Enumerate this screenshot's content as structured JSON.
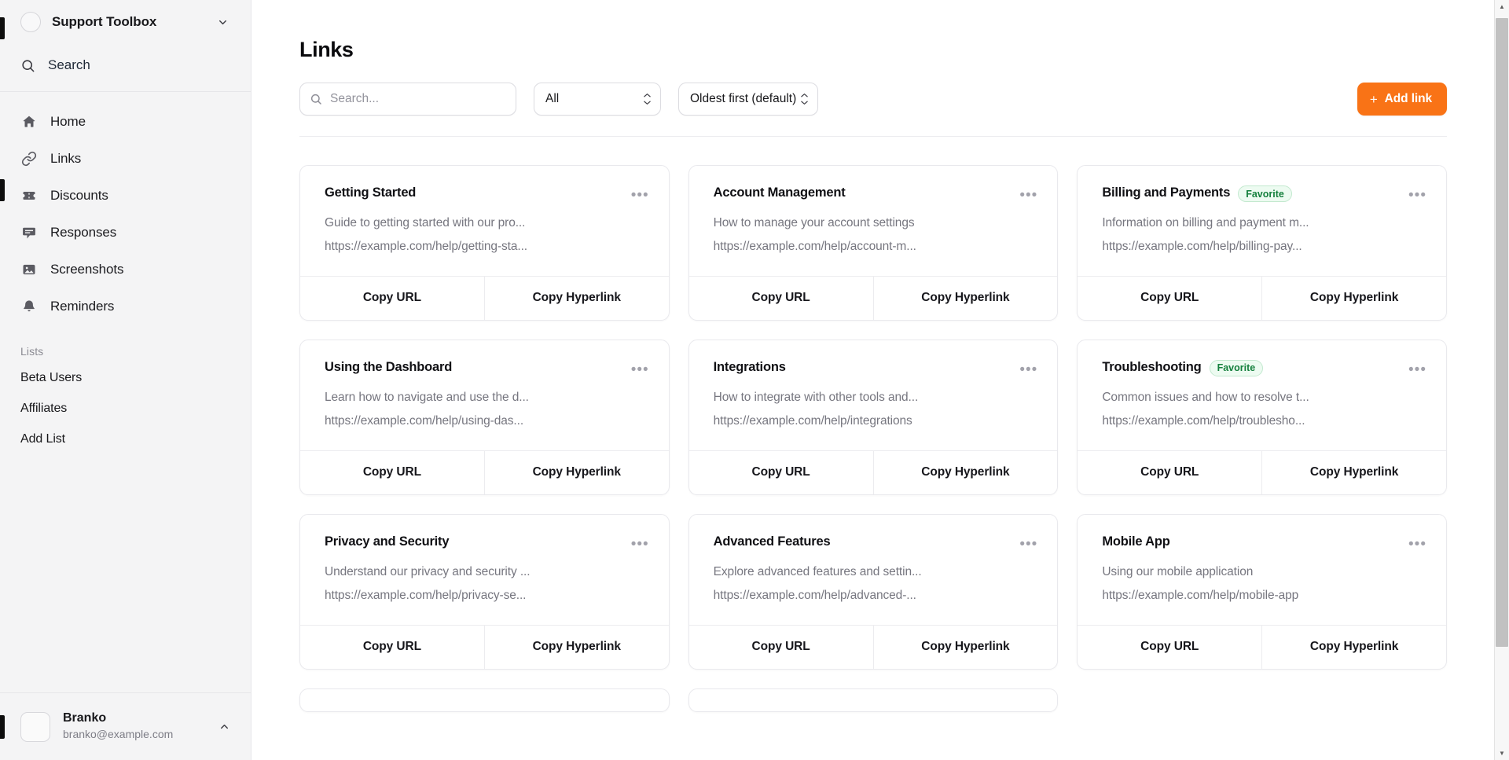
{
  "sidebar": {
    "workspace": {
      "name": "Support Toolbox",
      "chevron_icon": "chevron-down-icon"
    },
    "search": {
      "label": "Search",
      "icon": "search-icon"
    },
    "nav": [
      {
        "label": "Home",
        "icon": "home-icon"
      },
      {
        "label": "Links",
        "icon": "link-icon"
      },
      {
        "label": "Discounts",
        "icon": "ticket-icon"
      },
      {
        "label": "Responses",
        "icon": "chat-icon"
      },
      {
        "label": "Screenshots",
        "icon": "image-icon"
      },
      {
        "label": "Reminders",
        "icon": "bell-icon"
      }
    ],
    "lists_heading": "Lists",
    "lists": [
      {
        "label": "Beta Users"
      },
      {
        "label": "Affiliates"
      },
      {
        "label": "Add List"
      }
    ],
    "user": {
      "name": "Branko",
      "email": "branko@example.com",
      "chevron_icon": "chevron-up-icon"
    }
  },
  "header": {
    "title": "Links"
  },
  "toolbar": {
    "search": {
      "placeholder": "Search...",
      "value": "",
      "icon": "search-icon"
    },
    "filter": {
      "value": "All",
      "icon": "chevron-updown-icon"
    },
    "sort": {
      "value": "Oldest first (default)",
      "icon": "chevron-updown-icon"
    },
    "add_button": {
      "label": "Add link",
      "plus": "+",
      "color": "#f97316"
    }
  },
  "cards": {
    "copy_url_label": "Copy URL",
    "copy_hyperlink_label": "Copy Hyperlink",
    "menu_icon": "ellipsis-icon",
    "badge_color": "#15803d",
    "items": [
      {
        "title": "Getting Started",
        "badge": "",
        "description": "Guide to getting started with our pro...",
        "url": "https://example.com/help/getting-sta..."
      },
      {
        "title": "Account Management",
        "badge": "",
        "description": "How to manage your account settings",
        "url": "https://example.com/help/account-m..."
      },
      {
        "title": "Billing and Payments",
        "badge": "Favorite",
        "description": "Information on billing and payment m...",
        "url": "https://example.com/help/billing-pay..."
      },
      {
        "title": "Using the Dashboard",
        "badge": "",
        "description": "Learn how to navigate and use the d...",
        "url": "https://example.com/help/using-das..."
      },
      {
        "title": "Integrations",
        "badge": "",
        "description": "How to integrate with other tools and...",
        "url": "https://example.com/help/integrations"
      },
      {
        "title": "Troubleshooting",
        "badge": "Favorite",
        "description": "Common issues and how to resolve t...",
        "url": "https://example.com/help/troublesho..."
      },
      {
        "title": "Privacy and Security",
        "badge": "",
        "description": "Understand our privacy and security ...",
        "url": "https://example.com/help/privacy-se..."
      },
      {
        "title": "Advanced Features",
        "badge": "",
        "description": "Explore advanced features and settin...",
        "url": "https://example.com/help/advanced-..."
      },
      {
        "title": "Mobile App",
        "badge": "",
        "description": "Using our mobile application",
        "url": "https://example.com/help/mobile-app"
      }
    ]
  },
  "scrollbar": {
    "up_icon": "triangle-up-icon",
    "down_icon": "triangle-down-icon"
  }
}
